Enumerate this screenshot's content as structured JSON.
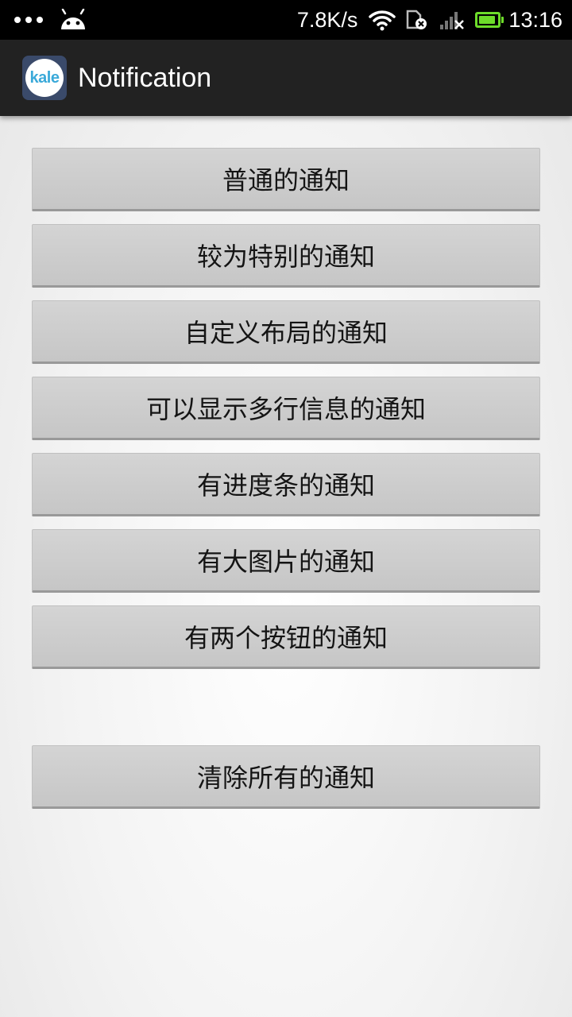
{
  "status_bar": {
    "net_speed": "7.8K/s",
    "time": "13:16",
    "battery_level": 0.9,
    "battery_color": "#6ddc2a",
    "icons": [
      "more-dots-icon",
      "android-icon",
      "wifi-icon",
      "sim-card-x-icon",
      "signal-x-icon",
      "battery-icon"
    ]
  },
  "action_bar": {
    "app_icon_text": "kale",
    "title": "Notification"
  },
  "buttons": [
    {
      "label": "普通的通知"
    },
    {
      "label": "较为特别的通知"
    },
    {
      "label": "自定义布局的通知"
    },
    {
      "label": "可以显示多行信息的通知"
    },
    {
      "label": "有进度条的通知"
    },
    {
      "label": "有大图片的通知"
    },
    {
      "label": "有两个按钮的通知"
    }
  ],
  "clear_button": {
    "label": "清除所有的通知"
  }
}
